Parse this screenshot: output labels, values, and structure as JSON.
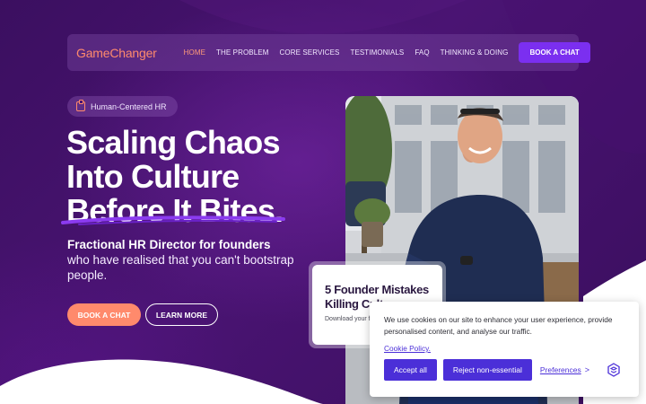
{
  "brand": {
    "logo_text": "GameChanger"
  },
  "nav": {
    "items": [
      {
        "label": "HOME",
        "active": true
      },
      {
        "label": "THE PROBLEM",
        "active": false
      },
      {
        "label": "CORE SERVICES",
        "active": false
      },
      {
        "label": "TESTIMONIALS",
        "active": false
      },
      {
        "label": "FAQ",
        "active": false
      },
      {
        "label": "THINKING & DOING",
        "active": false
      }
    ],
    "cta_label": "BOOK A CHAT"
  },
  "hero": {
    "pill_label": "Human-Centered HR",
    "headline": [
      "Scaling Chaos",
      "Into Culture",
      "Before It Bites."
    ],
    "subheading_bold": "Fractional HR Director for founders",
    "subheading_rest": "who have realised that you can't bootstrap people.",
    "primary_button": "BOOK A CHAT",
    "secondary_button": "LEARN MORE"
  },
  "guide_card": {
    "title": "5 Founder Mistakes Killing Culture",
    "text": "Download your free guide for scaling"
  },
  "cookie_banner": {
    "message": "We use cookies on our site to enhance your user experience, provide personalised content, and analyse our traffic.",
    "policy_link": "Cookie Policy.",
    "accept_label": "Accept all",
    "reject_label": "Reject non-essential",
    "preferences_label": "Preferences",
    "preferences_arrow": ">"
  },
  "colors": {
    "accent_coral": "#ff8a6c",
    "accent_purple": "#7b2ff0",
    "cookie_blue": "#4b2fd8",
    "background": "#3a0f5e"
  },
  "icons": {
    "pill": "clipboard-icon",
    "cookie_settings": "cookie-settings-icon"
  }
}
